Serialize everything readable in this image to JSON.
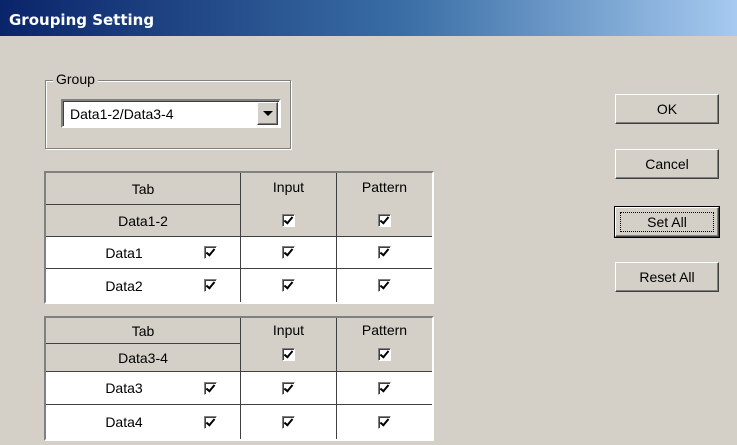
{
  "window": {
    "title": "Grouping Setting"
  },
  "group": {
    "legend": "Group",
    "selected": "Data1-2/Data3-4"
  },
  "buttons": {
    "ok": "OK",
    "cancel": "Cancel",
    "set_all": "Set All",
    "reset_all": "Reset All"
  },
  "tables": [
    {
      "headers": {
        "tab": "Tab",
        "input": "Input",
        "pattern": "Pattern"
      },
      "group_label": "Data1-2",
      "group_input_checked": true,
      "group_pattern_checked": true,
      "rows": [
        {
          "label": "Data1",
          "tab_checked": true,
          "input_checked": true,
          "pattern_checked": true
        },
        {
          "label": "Data2",
          "tab_checked": true,
          "input_checked": true,
          "pattern_checked": true
        }
      ]
    },
    {
      "headers": {
        "tab": "Tab",
        "input": "Input",
        "pattern": "Pattern"
      },
      "group_label": "Data3-4",
      "group_input_checked": true,
      "group_pattern_checked": true,
      "rows": [
        {
          "label": "Data3",
          "tab_checked": true,
          "input_checked": true,
          "pattern_checked": true
        },
        {
          "label": "Data4",
          "tab_checked": true,
          "input_checked": true,
          "pattern_checked": true
        }
      ]
    }
  ]
}
